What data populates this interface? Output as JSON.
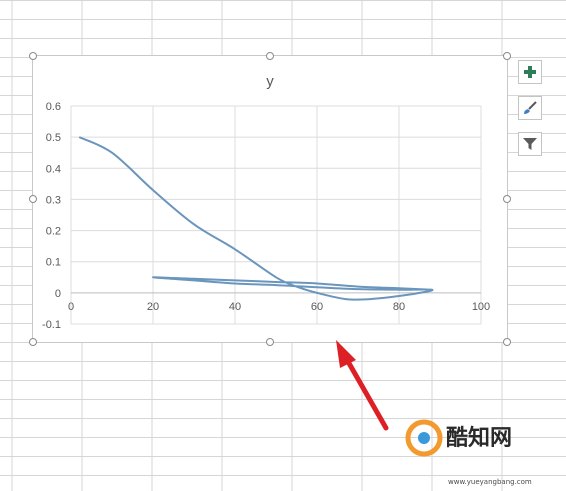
{
  "chart_data": {
    "type": "scatter",
    "title": "y",
    "xlabel": "",
    "ylabel": "",
    "xlim": [
      0,
      100
    ],
    "ylim": [
      -0.1,
      0.6
    ],
    "x_ticks": [
      "0",
      "20",
      "40",
      "60",
      "80",
      "100"
    ],
    "y_ticks": [
      "-0.1",
      "0",
      "0.1",
      "0.2",
      "0.3",
      "0.4",
      "0.5",
      "0.6"
    ],
    "grid": true,
    "legend": "none",
    "line_color": "#6a95bd",
    "series": [
      {
        "values": [
          [
            2,
            0.5
          ],
          [
            10,
            0.45
          ],
          [
            20,
            0.33
          ],
          [
            30,
            0.22
          ],
          [
            40,
            0.14
          ],
          [
            50,
            0.05
          ],
          [
            55,
            0.02
          ],
          [
            60,
            0.0
          ],
          [
            67,
            -0.02
          ],
          [
            73,
            -0.02
          ],
          [
            80,
            -0.01
          ],
          [
            85,
            0.0
          ],
          [
            88,
            0.01
          ],
          [
            80,
            0.01
          ],
          [
            70,
            0.012
          ],
          [
            60,
            0.018
          ],
          [
            50,
            0.025
          ],
          [
            40,
            0.03
          ],
          [
            30,
            0.04
          ],
          [
            20,
            0.05
          ],
          [
            30,
            0.045
          ],
          [
            40,
            0.04
          ],
          [
            50,
            0.035
          ],
          [
            60,
            0.03
          ],
          [
            70,
            0.02
          ],
          [
            80,
            0.015
          ],
          [
            88,
            0.01
          ]
        ]
      }
    ]
  },
  "side_buttons": {
    "add_icon": "plus-icon",
    "style_icon": "paintbrush-icon",
    "filter_icon": "funnel-icon"
  },
  "watermark": {
    "brand": "酷知网",
    "site": "www.yueyangbang.com"
  }
}
